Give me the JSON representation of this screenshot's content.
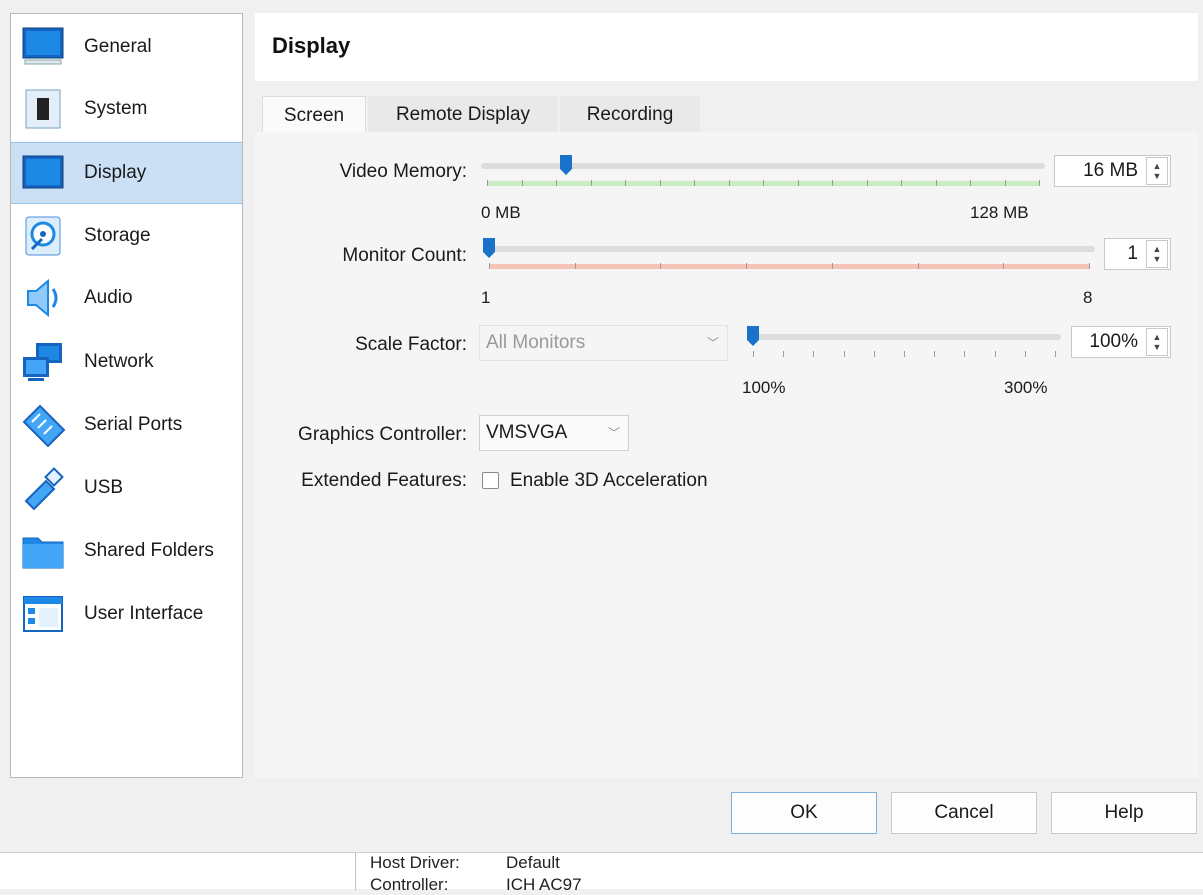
{
  "sidebar": {
    "items": [
      {
        "label": "General",
        "icon": "general-icon"
      },
      {
        "label": "System",
        "icon": "system-icon"
      },
      {
        "label": "Display",
        "icon": "display-icon",
        "selected": true
      },
      {
        "label": "Storage",
        "icon": "storage-icon"
      },
      {
        "label": "Audio",
        "icon": "audio-icon"
      },
      {
        "label": "Network",
        "icon": "network-icon"
      },
      {
        "label": "Serial Ports",
        "icon": "serial-ports-icon"
      },
      {
        "label": "USB",
        "icon": "usb-icon"
      },
      {
        "label": "Shared Folders",
        "icon": "shared-folders-icon"
      },
      {
        "label": "User Interface",
        "icon": "user-interface-icon"
      }
    ]
  },
  "header": {
    "title": "Display"
  },
  "tabs": [
    {
      "label": "Screen",
      "active": true
    },
    {
      "label": "Remote Display",
      "active": false
    },
    {
      "label": "Recording",
      "active": false
    }
  ],
  "screen": {
    "video_memory": {
      "label": "Video Memory:",
      "value": "16 MB",
      "min_label": "0 MB",
      "max_label": "128 MB",
      "fraction": 0.143
    },
    "monitor_count": {
      "label": "Monitor Count:",
      "value": "1",
      "min_label": "1",
      "max_label": "8",
      "fraction": 0.0
    },
    "scale_factor": {
      "label": "Scale Factor:",
      "combo": "All Monitors",
      "value": "100%",
      "min_label": "100%",
      "max_label": "300%",
      "fraction": 0.0
    },
    "graphics_controller": {
      "label": "Graphics Controller:",
      "value": "VMSVGA"
    },
    "extended_features": {
      "label": "Extended Features:",
      "checkbox_label": "Enable 3D Acceleration",
      "checked": false
    }
  },
  "buttons": {
    "ok": "OK",
    "cancel": "Cancel",
    "help": "Help"
  },
  "statusbar": {
    "host_driver_label": "Host Driver:",
    "host_driver_value": "Default",
    "controller_label": "Controller:",
    "controller_value": "ICH AC97"
  },
  "colors": {
    "accent": "#1a73c9",
    "selected_bg": "#cce0f5",
    "green_band": "#bfe6b8",
    "red_band": "#f2b8a8"
  }
}
